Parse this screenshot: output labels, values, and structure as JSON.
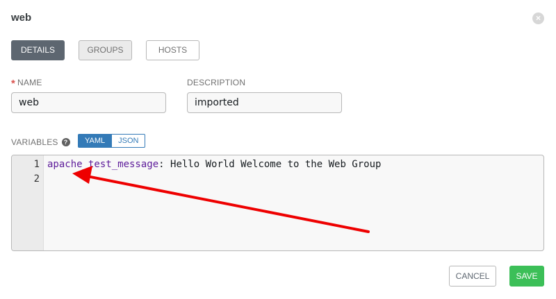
{
  "modal": {
    "title": "web",
    "close_glyph": "×"
  },
  "tabs": [
    {
      "label": "DETAILS",
      "active": true
    },
    {
      "label": "GROUPS",
      "active": false
    },
    {
      "label": "HOSTS",
      "active": false
    }
  ],
  "form": {
    "name": {
      "label": "NAME",
      "required_marker": "*",
      "value": "web"
    },
    "description": {
      "label": "DESCRIPTION",
      "value": "imported"
    },
    "variables": {
      "label": "VARIABLES",
      "help_glyph": "?",
      "toggle": {
        "yaml": "YAML",
        "json": "JSON",
        "selected": "YAML"
      },
      "line_numbers": [
        "1",
        "2"
      ],
      "code_key": "apache_test_message",
      "code_value": ": Hello World Welcome to the Web Group"
    }
  },
  "actions": {
    "cancel": "CANCEL",
    "save": "SAVE"
  },
  "colors": {
    "active_tab": "#5d6670",
    "toggle_selected": "#337ab7",
    "save": "#3cbf58",
    "annotation_arrow": "#ee0000",
    "code_key": "#5c1a99"
  },
  "icons": {
    "close": "close-circle-icon",
    "help": "question-circle-icon"
  }
}
